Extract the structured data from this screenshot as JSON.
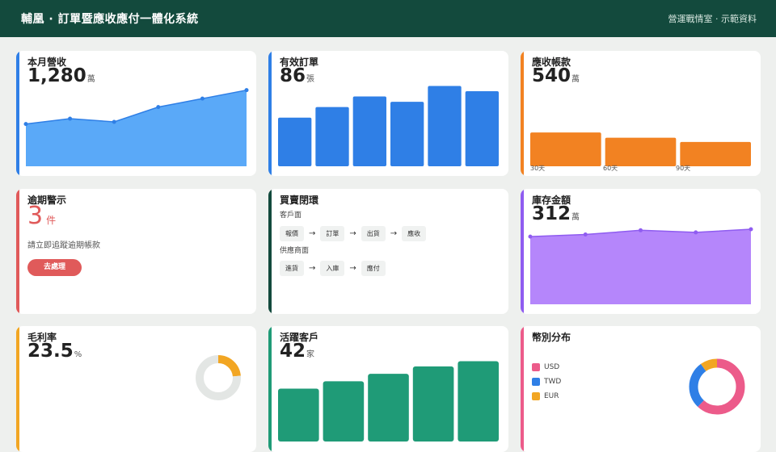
{
  "header": {
    "title": "輔凰 · 訂單暨應收應付一體化系統",
    "right_text": "營運戰情室 · 示範資料"
  },
  "colors": {
    "blue": "#2f7fe6",
    "light_blue": "#5aa9f8",
    "orange": "#f28222",
    "red": "#e05a5a",
    "dark_green": "#134a3d",
    "purple": "#8f5cf0",
    "light_purple": "#b586fb",
    "yellow": "#f2a623",
    "green": "#1f9b77",
    "pink": "#ec5b8a"
  },
  "cards": {
    "revenue": {
      "title": "本月營收",
      "value": "1,280",
      "unit": "萬"
    },
    "orders": {
      "title": "有效訂單",
      "value": "86",
      "unit": "張"
    },
    "ar": {
      "title": "應收帳款",
      "value": "540",
      "unit": "萬"
    },
    "overdue": {
      "title": "逾期警示",
      "value": "3",
      "unit": "件",
      "message": "請立即追蹤逾期帳款",
      "button": "去處理"
    },
    "loop": {
      "title": "買賣閉環",
      "customer_label": "客戶面",
      "customer_steps": [
        "報價",
        "訂單",
        "出貨",
        "應收"
      ],
      "supplier_label": "供應商面",
      "supplier_steps": [
        "進貨",
        "入庫",
        "應付"
      ],
      "arrow": "→"
    },
    "inventory": {
      "title": "庫存金額",
      "value": "312",
      "unit": "萬"
    },
    "margin": {
      "title": "毛利率",
      "value": "23.5",
      "unit": "%"
    },
    "customers": {
      "title": "活躍客戶",
      "value": "42",
      "unit": "家"
    },
    "currency": {
      "title": "幣別分布"
    }
  },
  "chart_data": [
    {
      "id": "revenue-trend",
      "type": "area",
      "values": [
        4,
        4.5,
        4.2,
        5.6,
        6.4,
        7.2
      ],
      "ylim": [
        0,
        10
      ],
      "color": "#5aa9f8",
      "point_color": "#2f7fe6"
    },
    {
      "id": "orders-bars",
      "type": "bar",
      "values": [
        4.6,
        5.6,
        6.6,
        6.1,
        7.6,
        7.1
      ],
      "ylim": [
        0,
        10
      ],
      "color": "#2f7fe6"
    },
    {
      "id": "ar-aging",
      "type": "bar",
      "categories": [
        "30天",
        "60天",
        "90天"
      ],
      "values": [
        32,
        27,
        23
      ],
      "ylim": [
        0,
        100
      ],
      "color": "#f28222"
    },
    {
      "id": "inventory-trend",
      "type": "area",
      "values": [
        6.4,
        6.6,
        7,
        6.8,
        7.1
      ],
      "ylim": [
        0,
        10
      ],
      "color": "#b586fb",
      "point_color": "#8f5cf0"
    },
    {
      "id": "margin-gauge",
      "type": "pie",
      "values": [
        23.5,
        76.5
      ],
      "colors": [
        "#f2a623",
        "#e3e6e4"
      ]
    },
    {
      "id": "customers-bars",
      "type": "bar",
      "values": [
        5,
        5.7,
        6.4,
        7.1,
        7.6
      ],
      "ylim": [
        0,
        10
      ],
      "color": "#1f9b77"
    },
    {
      "id": "currency-dist",
      "type": "pie",
      "categories": [
        "USD",
        "TWD",
        "EUR"
      ],
      "values": [
        62,
        28,
        10
      ],
      "colors": [
        "#ec5b8a",
        "#2f7fe6",
        "#f2a623"
      ]
    }
  ]
}
